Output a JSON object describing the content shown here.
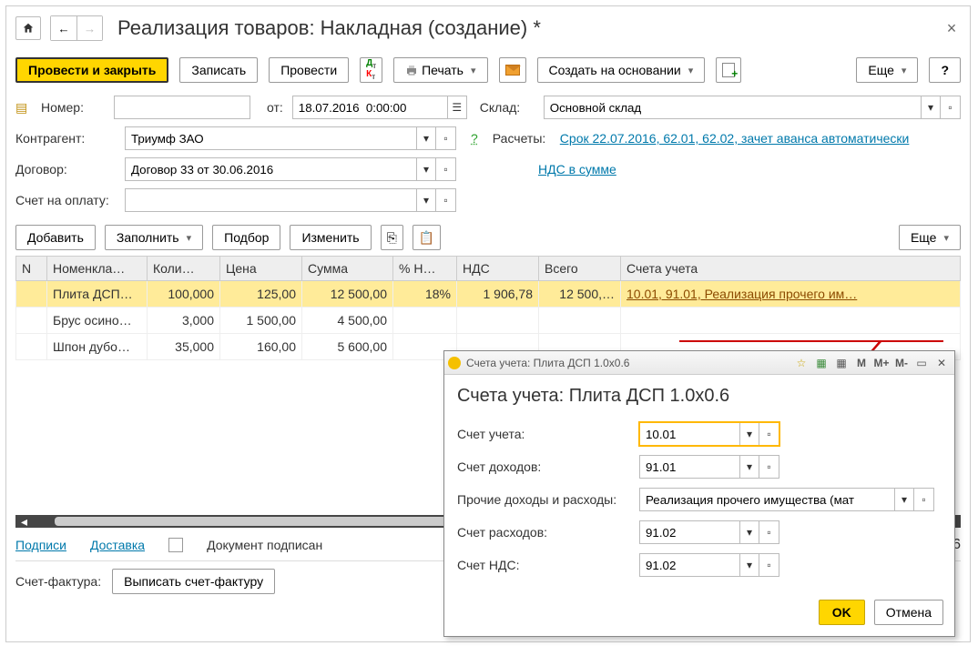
{
  "header": {
    "title": "Реализация товаров: Накладная (создание) *"
  },
  "toolbar": {
    "post_close": "Провести и закрыть",
    "save": "Записать",
    "post": "Провести",
    "print": "Печать",
    "create_from": "Создать на основании",
    "more": "Еще"
  },
  "form": {
    "number_label": "Номер:",
    "date_label": "от:",
    "date_value": "18.07.2016  0:00:00",
    "warehouse_label": "Склад:",
    "warehouse_value": "Основной склад",
    "counterparty_label": "Контрагент:",
    "counterparty_value": "Триумф ЗАО",
    "contract_label": "Договор:",
    "contract_value": "Договор 33 от 30.06.2016",
    "invoice_label": "Счет на оплату:",
    "calc_label": "Расчеты:",
    "calc_link": "Срок 22.07.2016, 62.01, 62.02, зачет аванса автоматически",
    "vat_link": "НДС в сумме"
  },
  "table_toolbar": {
    "add": "Добавить",
    "fill": "Заполнить",
    "select": "Подбор",
    "change": "Изменить",
    "more": "Еще"
  },
  "columns": {
    "n": "N",
    "item": "Номенкла…",
    "qty": "Коли…",
    "price": "Цена",
    "sum": "Сумма",
    "vat_pct": "% Н…",
    "vat": "НДС",
    "total": "Всего",
    "accounts": "Счета учета"
  },
  "rows": [
    {
      "item": "Плита ДСП…",
      "qty": "100,000",
      "price": "125,00",
      "sum": "12 500,00",
      "vat_pct": "18%",
      "vat": "1 906,78",
      "total": "12 500,…",
      "accounts": "10.01, 91.01, Реализация прочего им…"
    },
    {
      "item": "Брус осино…",
      "qty": "3,000",
      "price": "1 500,00",
      "sum": "4 500,00",
      "vat_pct": "",
      "vat": "",
      "total": "",
      "accounts": ""
    },
    {
      "item": "Шпон дубо…",
      "qty": "35,000",
      "price": "160,00",
      "sum": "5 600,00",
      "vat_pct": "",
      "vat": "",
      "total": "",
      "accounts": ""
    }
  ],
  "footer": {
    "signatures": "Подписи",
    "delivery": "Доставка",
    "signed": "Документ подписан",
    "total_suffix": "7,46",
    "sf_label": "Счет-фактура:",
    "sf_button": "Выписать счет-фактуру"
  },
  "popup": {
    "bar_title": "Счета учета: Плита ДСП 1.0х0.6",
    "title": "Счета учета: Плита ДСП 1.0x0.6",
    "m": "M",
    "mplus": "M+",
    "mminus": "M-",
    "acct_label": "Счет учета:",
    "acct_value": "10.01",
    "income_label": "Счет доходов:",
    "income_value": "91.01",
    "other_label": "Прочие доходы и расходы:",
    "other_value": "Реализация прочего имущества (мат",
    "expense_label": "Счет расходов:",
    "expense_value": "91.02",
    "vat_label": "Счет НДС:",
    "vat_value": "91.02",
    "ok": "OK",
    "cancel": "Отмена"
  }
}
